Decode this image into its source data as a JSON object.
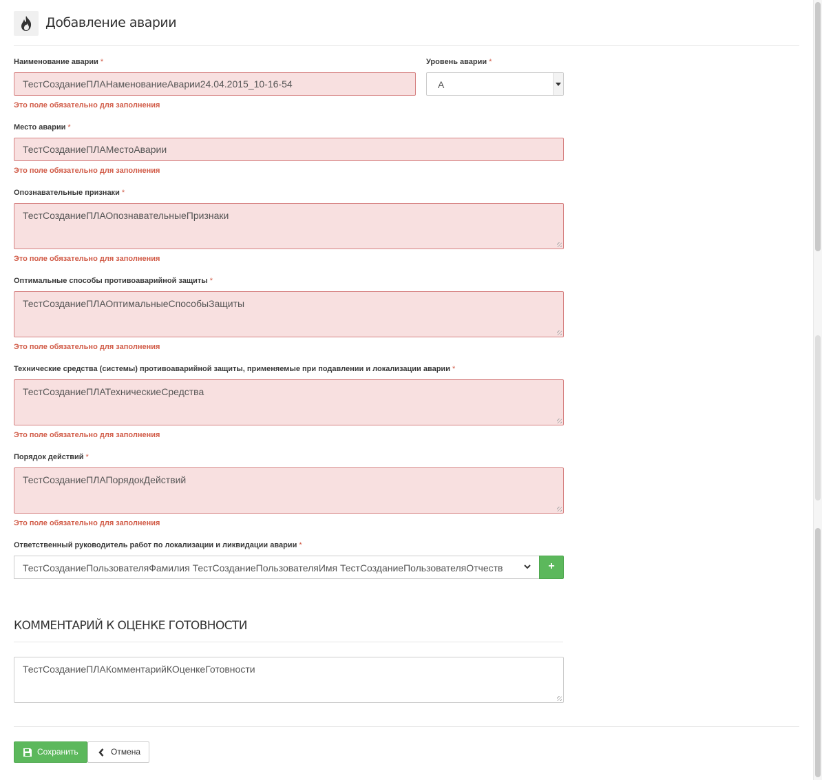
{
  "header": {
    "icon": "fire-icon",
    "title": "Добавление аварии"
  },
  "form": {
    "required_mark": "*",
    "error_text": "Это поле обязательно для заполнения",
    "name": {
      "label": "Наименование аварии",
      "value": "ТестСозданиеПЛАНаменованиеАварии24.04.2015_10-16-54"
    },
    "level": {
      "label": "Уровень аварии",
      "value": "А"
    },
    "place": {
      "label": "Место аварии",
      "value": "ТестСозданиеПЛАМестоАварии"
    },
    "signs": {
      "label": "Опознавательные признаки",
      "value": "ТестСозданиеПЛАОпознавательныеПризнаки"
    },
    "methods": {
      "label": "Оптимальные способы противоаварийной защиты",
      "value": "ТестСозданиеПЛАОптимальныеСпособыЗащиты"
    },
    "tech": {
      "label": "Технические средства (системы) противоаварийной защиты, применяемые при подавлении и локализации аварии",
      "value": "ТестСозданиеПЛАТехническиеСредства"
    },
    "order": {
      "label": "Порядок действий",
      "value": "ТестСозданиеПЛАПорядокДействий"
    },
    "responsible": {
      "label": "Ответственный руководитель работ по локализации и ликвидации аварии",
      "value": "ТестСозданиеПользователяФамилия ТестСозданиеПользователяИмя ТестСозданиеПользователяОтчеств",
      "add_label": "+"
    }
  },
  "comment": {
    "title": "КОММЕНТАРИЙ К ОЦЕНКЕ ГОТОВНОСТИ",
    "value": "ТестСозданиеПЛАКомментарийКОценкеГотовности"
  },
  "actions": {
    "save_label": "Сохранить",
    "cancel_label": "Отмена"
  },
  "colors": {
    "error": "#d15b47",
    "error_bg": "#f8e0e0",
    "success": "#5cb85c"
  }
}
